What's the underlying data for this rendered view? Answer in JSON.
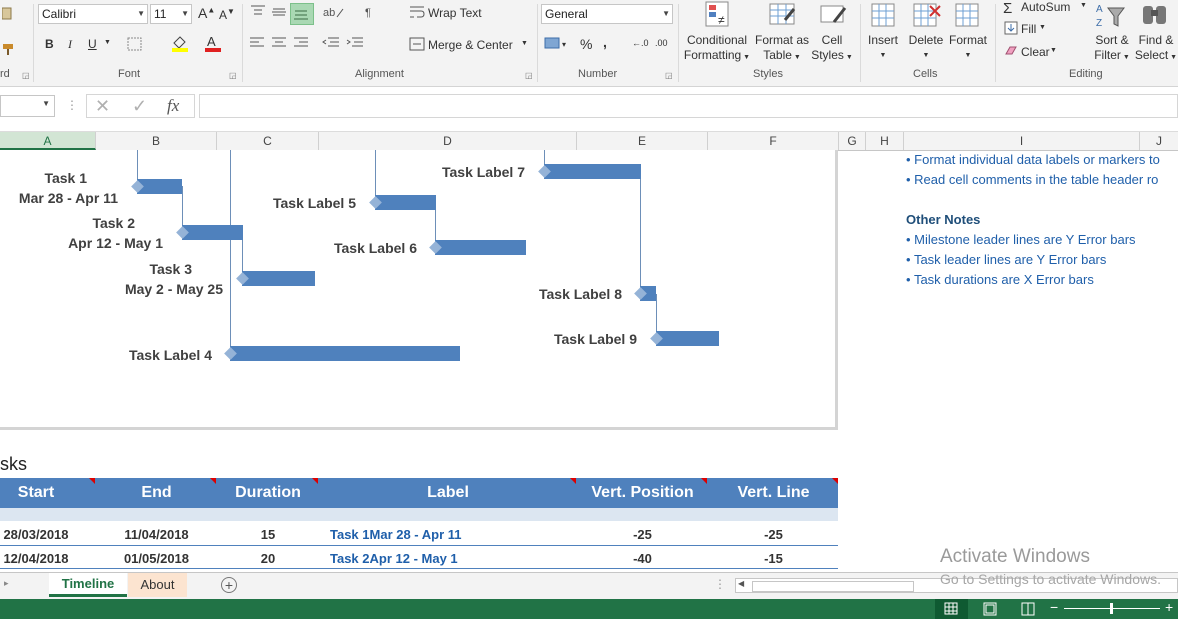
{
  "ribbon": {
    "font_name": "Calibri",
    "font_size": "11",
    "wrap_text": "Wrap Text",
    "merge_center": "Merge & Center",
    "number_format": "General",
    "conditional_formatting": [
      "Conditional",
      "Formatting"
    ],
    "format_as_table": [
      "Format as",
      "Table"
    ],
    "cell_styles": [
      "Cell",
      "Styles"
    ],
    "insert": "Insert",
    "delete": "Delete",
    "format": "Format",
    "autosum": "AutoSum",
    "fill": "Fill",
    "clear": "Clear",
    "sort_filter": [
      "Sort &",
      "Filter"
    ],
    "find_select": [
      "Find &",
      "Select"
    ],
    "groups": {
      "clipboard_tail": "rd",
      "font": "Font",
      "alignment": "Alignment",
      "number": "Number",
      "styles": "Styles",
      "cells": "Cells",
      "editing": "Editing"
    }
  },
  "formula_bar": {
    "name_box": "",
    "fx": "fx",
    "formula": ""
  },
  "columns": [
    "A",
    "B",
    "C",
    "D",
    "E",
    "F",
    "G",
    "H",
    "I",
    "J"
  ],
  "chart": {
    "tasks": [
      {
        "label1": "Task 1",
        "label2": "Mar 28 - Apr 11"
      },
      {
        "label1": "Task 2",
        "label2": "Apr 12 - May 1"
      },
      {
        "label1": "Task 3",
        "label2": "May 2 - May 25"
      },
      {
        "label1": "Task Label 4"
      },
      {
        "label1": "Task Label 5"
      },
      {
        "label1": "Task Label 6"
      },
      {
        "label1": "Task Label 7"
      },
      {
        "label1": "Task Label 8"
      },
      {
        "label1": "Task Label 9"
      }
    ]
  },
  "notes": {
    "bullets_top": [
      "Format individual data labels or markers to",
      "Read cell comments in the table header ro"
    ],
    "other_title": "Other Notes",
    "other_bullets": [
      "Milestone leader lines are Y Error bars",
      "Task leader lines are Y Error bars",
      "Task durations are X Error bars"
    ]
  },
  "table": {
    "section_title": "sks",
    "headers": [
      "Start",
      "End",
      "Duration",
      "Label",
      "Vert. Position",
      "Vert. Line"
    ],
    "rows": [
      [
        "28/03/2018",
        "11/04/2018",
        "15",
        "Task 1Mar 28 - Apr 11",
        "-25",
        "-25"
      ],
      [
        "12/04/2018",
        "01/05/2018",
        "20",
        "Task 2Apr 12 - May 1",
        "-40",
        "-15"
      ]
    ]
  },
  "sheet_tabs": [
    {
      "label": "Timeline",
      "active": true
    },
    {
      "label": "About",
      "active": false
    }
  ],
  "watermark": {
    "line1": "Activate Windows",
    "line2": "Go to Settings to activate Windows."
  },
  "colors": {
    "accent": "#217346",
    "bar": "#4f81bd",
    "header": "#4f81bd",
    "note": "#1f5faa"
  }
}
